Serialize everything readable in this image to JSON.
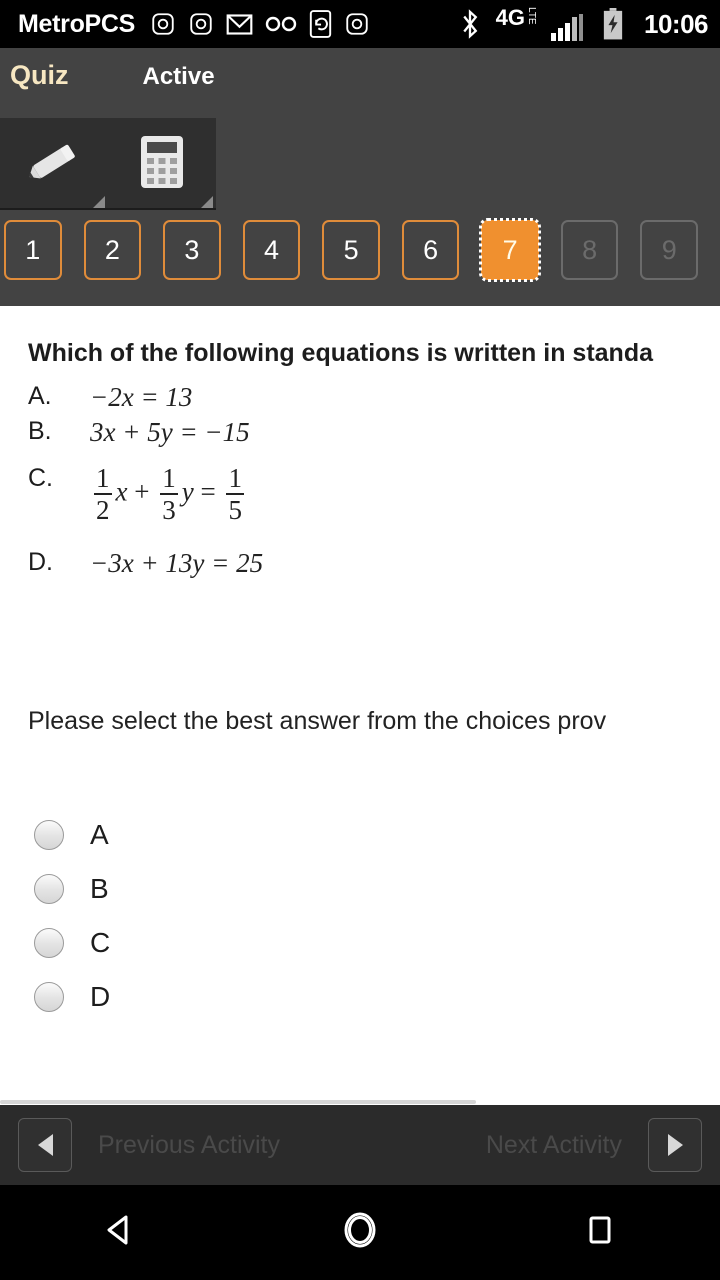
{
  "statusbar": {
    "carrier": "MetroPCS",
    "network": "4G",
    "network_sub": "LTE",
    "clock": "10:06",
    "icons": [
      "instagram-icon",
      "instagram-icon",
      "gmail-icon",
      "voicemail-icon",
      "phone-sync-icon",
      "instagram-icon"
    ],
    "right_icons": [
      "bluetooth-icon",
      "network-4glte-icon",
      "signal-bars-icon",
      "battery-charging-icon"
    ]
  },
  "header": {
    "title": "Quiz",
    "state": "Active",
    "tools": [
      {
        "name": "pencil-tool",
        "icon": "pencil-icon"
      },
      {
        "name": "calculator-tool",
        "icon": "calculator-icon"
      }
    ],
    "question_numbers": [
      {
        "label": "1",
        "state": "available"
      },
      {
        "label": "2",
        "state": "available"
      },
      {
        "label": "3",
        "state": "available"
      },
      {
        "label": "4",
        "state": "available"
      },
      {
        "label": "5",
        "state": "available"
      },
      {
        "label": "6",
        "state": "available"
      },
      {
        "label": "7",
        "state": "current"
      },
      {
        "label": "8",
        "state": "disabled"
      },
      {
        "label": "9",
        "state": "disabled"
      }
    ]
  },
  "main": {
    "question": "Which of the following equations is written in standa",
    "choices": [
      {
        "letter": "A.",
        "equation": "−2x = 13"
      },
      {
        "letter": "B.",
        "equation": "3x + 5y = −15"
      },
      {
        "letter": "C.",
        "fraction": {
          "f1_num": "1",
          "f1_den": "2",
          "v1": "x",
          "op": "+",
          "f2_num": "1",
          "f2_den": "3",
          "v2": "y",
          "eq": "=",
          "f3_num": "1",
          "f3_den": "5"
        }
      },
      {
        "letter": "D.",
        "equation": "−3x + 13y = 25"
      }
    ],
    "instruction": "Please select the best answer from the choices prov",
    "answers": [
      {
        "label": "A",
        "selected": false
      },
      {
        "label": "B",
        "selected": false
      },
      {
        "label": "C",
        "selected": false
      },
      {
        "label": "D",
        "selected": false
      }
    ]
  },
  "footer": {
    "previous_label": "Previous Activity",
    "next_label": "Next Activity"
  },
  "softkeys": {
    "back": "back-icon",
    "home": "home-icon",
    "recents": "recents-icon"
  },
  "colors": {
    "accent_orange": "#f0902f",
    "header_bg": "#434343",
    "title_cream": "#f7e7c2",
    "footer_bg": "#2b2b2b"
  }
}
